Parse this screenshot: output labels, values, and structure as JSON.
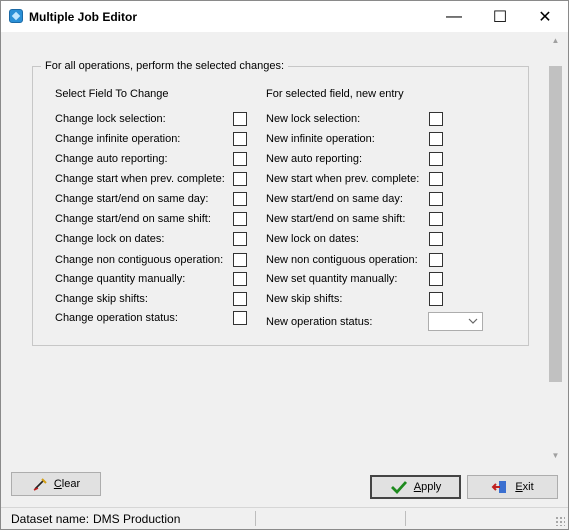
{
  "window": {
    "title": "Multiple Job Editor",
    "icon": "app-diamond-icon",
    "controls": {
      "minimize": "—",
      "maximize": "☐",
      "close": "✕"
    }
  },
  "group": {
    "legend": "For all operations, perform the selected changes:",
    "left_header": "Select Field To Change",
    "right_header": "For selected field, new entry",
    "left_rows": [
      "Change lock selection:",
      "Change infinite operation:",
      "Change auto reporting:",
      "Change start when prev. complete:",
      "Change start/end on same day:",
      "Change start/end on same shift:",
      "Change lock on dates:",
      "Change non contiguous operation:",
      "Change quantity manually:",
      "Change skip shifts:",
      "Change operation status:"
    ],
    "right_rows": [
      "New lock selection:",
      "New infinite operation:",
      "New auto reporting:",
      "New start when prev. complete:",
      "New start/end on same day:",
      "New start/end on same shift:",
      "New lock on dates:",
      "New non contiguous operation:",
      "New set quantity manually:",
      "New skip shifts:",
      "New operation status:"
    ],
    "operation_status_value": ""
  },
  "buttons": {
    "clear": "Clear",
    "apply": "Apply",
    "exit": "Exit"
  },
  "status": {
    "label": "Dataset name:",
    "value": "DMS Production"
  },
  "colors": {
    "title_bg": "#ffffff",
    "window_bg": "#f0f0f0",
    "apply_check": "#1e8a1e",
    "exit_icon": "#c02020"
  }
}
